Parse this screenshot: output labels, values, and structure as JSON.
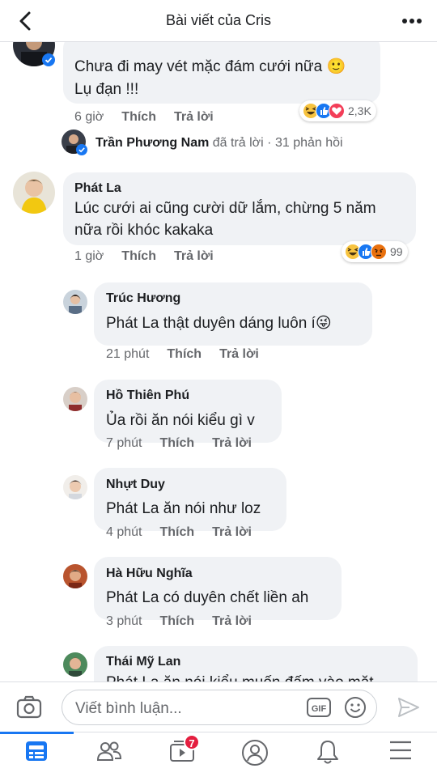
{
  "header": {
    "title": "Bài viết của Cris"
  },
  "comments": [
    {
      "name": "",
      "text_lines": [
        "Chưa đi may vét mặc đám cưới nữa 🙂",
        "Lụ đạn !!!"
      ],
      "time": "6 giờ",
      "like_label": "Thích",
      "reply_label": "Trả lời",
      "reaction_count": "2,3K",
      "reaction_icons": [
        "haha-icon",
        "like-icon",
        "love-icon"
      ]
    },
    {
      "name": "Phát La",
      "text_lines": [
        "Lúc cưới ai cũng cười dữ lắm, chừng 5 năm",
        "nữa rồi khóc kakaka"
      ],
      "time": "1 giờ",
      "like_label": "Thích",
      "reply_label": "Trả lời",
      "reaction_count": "99",
      "reaction_icons": [
        "haha-icon",
        "like-icon",
        "angry-icon"
      ]
    }
  ],
  "reply_summary": {
    "name": "Trần Phương Nam",
    "text": "đã trả lời · 31 phản hồi"
  },
  "replies": [
    {
      "name": "Trúc Hương",
      "text": "Phát La thật duyên dáng luôn í😜",
      "time": "21 phút",
      "like_label": "Thích",
      "reply_label": "Trả lời"
    },
    {
      "name": "Hồ Thiên Phú",
      "text": "Ủa rồi ăn nói kiểu gì v",
      "time": "7 phút",
      "like_label": "Thích",
      "reply_label": "Trả lời"
    },
    {
      "name": "Nhựt Duy",
      "text": "Phát La ăn nói như loz",
      "time": "4 phút",
      "like_label": "Thích",
      "reply_label": "Trả lời"
    },
    {
      "name": "Hà Hữu Nghĩa",
      "text": "Phát La có duyên chết liền ah",
      "time": "3 phút",
      "like_label": "Thích",
      "reply_label": "Trả lời"
    },
    {
      "name": "Thái Mỹ Lan",
      "text": "Phát La ăn nói kiểu muốn đấm vào mặt"
    }
  ],
  "composer": {
    "placeholder": "Viết bình luận...",
    "gif_label": "GIF"
  },
  "tabbar": {
    "items": [
      "news-feed-icon",
      "friends-icon",
      "watch-icon",
      "profile-icon",
      "notifications-icon",
      "menu-icon"
    ],
    "watch_badge": "7"
  },
  "colors": {
    "accent": "#1877f2",
    "bubble": "#f0f2f5",
    "meta": "#65676b",
    "badge": "#e41e3f"
  }
}
